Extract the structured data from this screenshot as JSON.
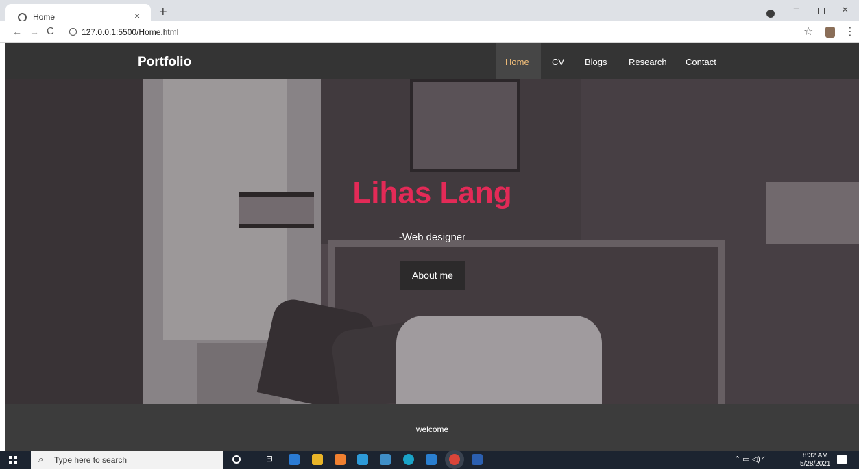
{
  "browser": {
    "tab_title": "Home",
    "tab_close": "×",
    "new_tab": "+",
    "url": "127.0.0.1:5500/Home.html",
    "back": "←",
    "forward": "→",
    "reload": "C",
    "star": "☆",
    "menu": "⋮",
    "window_min": "−",
    "window_close": "×"
  },
  "site": {
    "brand": "Portfolio",
    "nav": {
      "home": "Home",
      "cv": "CV",
      "blogs": "Blogs",
      "research": "Research",
      "contact": "Contact"
    },
    "active_nav": "Home",
    "hero": {
      "name": "Lihas Lang",
      "subtitle": "-Web designer",
      "button": "About me"
    },
    "footer": "welcome"
  },
  "taskbar": {
    "search_placeholder": "Type here to search",
    "search_icon": "⌕",
    "taskview": "⊟",
    "tray": "⌃ ▭ ◁) ◜",
    "time": "8:32 AM",
    "date": "5/28/2021"
  },
  "colors": {
    "navbar_bg": "#343434",
    "active_nav_text": "#f5c07a",
    "hero_name": "#e32a57",
    "footer_bg": "#3c3c3c",
    "taskbar_bg": "#1c2430"
  }
}
